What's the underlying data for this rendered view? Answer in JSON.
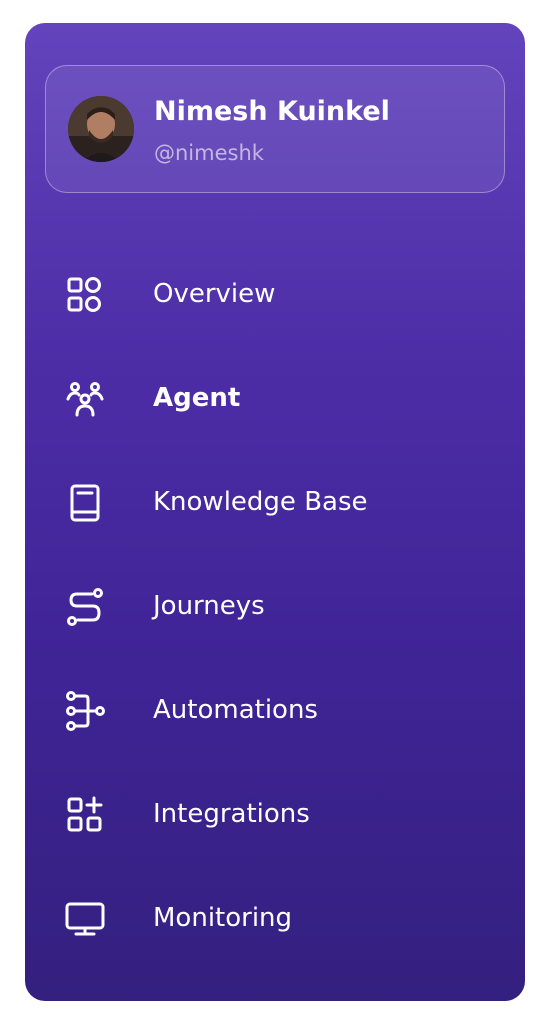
{
  "profile": {
    "name": "Nimesh Kuinkel",
    "handle": "@nimeshk"
  },
  "nav": {
    "items": [
      {
        "label": "Overview",
        "icon": "grid-shapes-icon"
      },
      {
        "label": "Agent",
        "icon": "users-group-icon",
        "active": true
      },
      {
        "label": "Knowledge Base",
        "icon": "book-icon"
      },
      {
        "label": "Journeys",
        "icon": "route-icon"
      },
      {
        "label": "Automations",
        "icon": "flow-nodes-icon"
      },
      {
        "label": "Integrations",
        "icon": "grid-plus-icon"
      },
      {
        "label": "Monitoring",
        "icon": "monitor-icon"
      }
    ]
  },
  "colors": {
    "gradient_top": "#6444bd",
    "gradient_bottom": "#34207f",
    "text": "#ffffff"
  }
}
